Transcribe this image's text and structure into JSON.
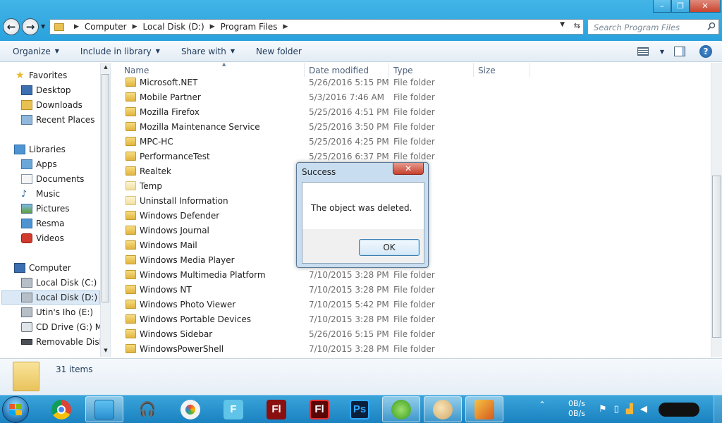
{
  "window": {
    "caption": {
      "minimize": "–",
      "maximize": "❐",
      "close": "✕"
    }
  },
  "nav": {
    "back": "←",
    "forward": "→"
  },
  "address": {
    "crumbs": [
      "Computer",
      "Local Disk (D:)",
      "Program Files"
    ],
    "search_placeholder": "Search Program Files"
  },
  "toolbar": {
    "organize": "Organize",
    "include_in_library": "Include in library",
    "share_with": "Share with",
    "new_folder": "New folder"
  },
  "sidebar": {
    "favorites": {
      "label": "Favorites",
      "items": [
        "Desktop",
        "Downloads",
        "Recent Places"
      ]
    },
    "libraries": {
      "label": "Libraries",
      "items": [
        "Apps",
        "Documents",
        "Music",
        "Pictures",
        "Resma",
        "Videos"
      ]
    },
    "computer": {
      "label": "Computer",
      "items": [
        "Local Disk (C:)",
        "Local Disk (D:)",
        "Utin's Iho (E:)",
        "CD Drive (G:) Mo",
        "Removable Disk ("
      ]
    },
    "selected": "Local Disk (D:)"
  },
  "columns": {
    "name": "Name",
    "date_modified": "Date modified",
    "type": "Type",
    "size": "Size"
  },
  "files": [
    {
      "name": "Microsoft.NET",
      "date": "5/26/2016 5:15 PM",
      "type": "File folder"
    },
    {
      "name": "Mobile Partner",
      "date": "5/3/2016 7:46 AM",
      "type": "File folder"
    },
    {
      "name": "Mozilla Firefox",
      "date": "5/25/2016 4:51 PM",
      "type": "File folder"
    },
    {
      "name": "Mozilla Maintenance Service",
      "date": "5/25/2016 3:50 PM",
      "type": "File folder"
    },
    {
      "name": "MPC-HC",
      "date": "5/25/2016 4:25 PM",
      "type": "File folder"
    },
    {
      "name": "PerformanceTest",
      "date": "5/25/2016 6:37 PM",
      "type": "File folder"
    },
    {
      "name": "Realtek",
      "date": "",
      "type": ""
    },
    {
      "name": "Temp",
      "date": "",
      "type": ""
    },
    {
      "name": "Uninstall Information",
      "date": "",
      "type": ""
    },
    {
      "name": "Windows Defender",
      "date": "",
      "type": ""
    },
    {
      "name": "Windows Journal",
      "date": "",
      "type": ""
    },
    {
      "name": "Windows Mail",
      "date": "",
      "type": ""
    },
    {
      "name": "Windows Media Player",
      "date": "",
      "type": ""
    },
    {
      "name": "Windows Multimedia Platform",
      "date": "7/10/2015 3:28 PM",
      "type": "File folder"
    },
    {
      "name": "Windows NT",
      "date": "7/10/2015 3:28 PM",
      "type": "File folder"
    },
    {
      "name": "Windows Photo Viewer",
      "date": "7/10/2015 5:42 PM",
      "type": "File folder"
    },
    {
      "name": "Windows Portable Devices",
      "date": "7/10/2015 3:28 PM",
      "type": "File folder"
    },
    {
      "name": "Windows Sidebar",
      "date": "5/26/2016 5:15 PM",
      "type": "File folder"
    },
    {
      "name": "WindowsPowerShell",
      "date": "7/10/2015 3:28 PM",
      "type": "File folder"
    }
  ],
  "details": {
    "count": "31 items"
  },
  "dialog": {
    "title": "Success",
    "close": "✕",
    "message": "The object was deleted.",
    "ok": "OK"
  },
  "taskbar": {
    "apps": [
      {
        "name": "chrome",
        "glyph": ""
      },
      {
        "name": "explorer",
        "glyph": ""
      },
      {
        "name": "music",
        "glyph": ""
      },
      {
        "name": "photos",
        "glyph": ""
      },
      {
        "name": "f-app",
        "glyph": "F"
      },
      {
        "name": "flash",
        "glyph": "Fl"
      },
      {
        "name": "flash-red",
        "glyph": "Fl"
      },
      {
        "name": "photoshop",
        "glyph": "Ps"
      },
      {
        "name": "green-app",
        "glyph": ""
      },
      {
        "name": "paint",
        "glyph": ""
      },
      {
        "name": "tool",
        "glyph": ""
      }
    ],
    "net_up": "0B/s",
    "net_down": "0B/s",
    "tray_arrow": "⌃"
  },
  "colors": {
    "accent": "#2a9ad4",
    "folder": "#e8c152",
    "selection": "#dbe9f6"
  }
}
